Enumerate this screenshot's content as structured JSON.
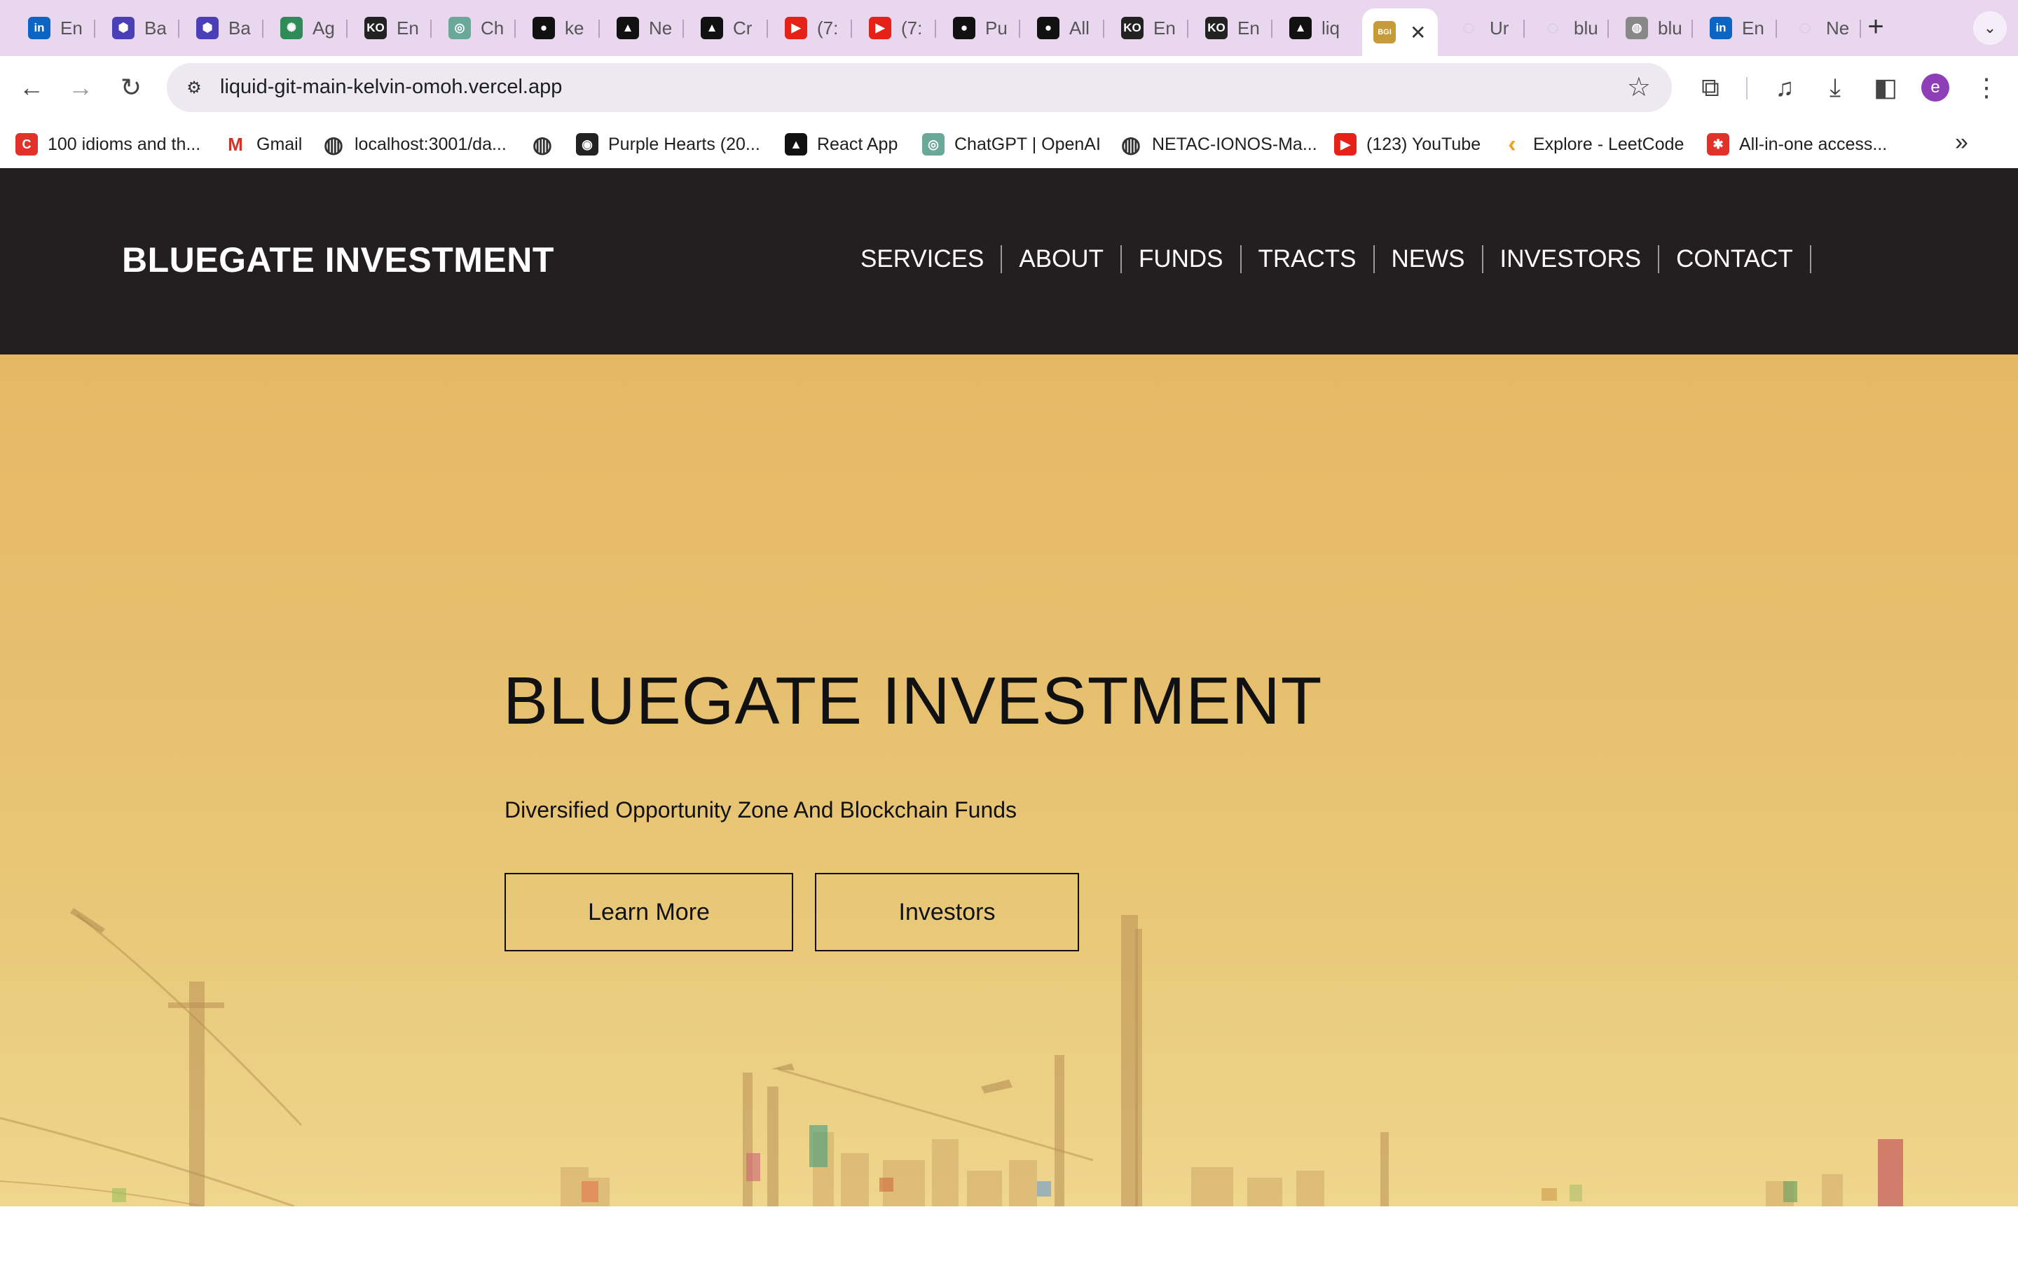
{
  "browser": {
    "tabs": [
      {
        "title": "En",
        "icon": "linkedin-icon",
        "color": "#0a66c2",
        "glyph": "in"
      },
      {
        "title": "Ba",
        "icon": "hexagon-icon",
        "color": "#4b3fb8",
        "glyph": "⬢"
      },
      {
        "title": "Ba",
        "icon": "hexagon-icon",
        "color": "#4b3fb8",
        "glyph": "⬢"
      },
      {
        "title": "Ag",
        "icon": "sparkle-icon",
        "color": "#2e8b57",
        "glyph": "✺"
      },
      {
        "title": "En",
        "icon": "ko-icon",
        "color": "#222222",
        "glyph": "KO"
      },
      {
        "title": "Ch",
        "icon": "openai-icon",
        "color": "#6aa89a",
        "glyph": "◎"
      },
      {
        "title": "ke",
        "icon": "github-icon",
        "color": "#111111",
        "glyph": "●"
      },
      {
        "title": "Ne",
        "icon": "vercel-icon",
        "color": "#111111",
        "glyph": "▲"
      },
      {
        "title": "Cr",
        "icon": "vercel-icon",
        "color": "#111111",
        "glyph": "▲"
      },
      {
        "title": "(7:",
        "icon": "youtube-icon",
        "color": "#e62117",
        "glyph": "▶"
      },
      {
        "title": "(7:",
        "icon": "youtube-icon",
        "color": "#e62117",
        "glyph": "▶"
      },
      {
        "title": "Pu",
        "icon": "github-icon",
        "color": "#111111",
        "glyph": "●"
      },
      {
        "title": "All",
        "icon": "github-icon",
        "color": "#111111",
        "glyph": "●"
      },
      {
        "title": "En",
        "icon": "ko-icon",
        "color": "#222222",
        "glyph": "KO"
      },
      {
        "title": "En",
        "icon": "ko-icon",
        "color": "#222222",
        "glyph": "KO"
      },
      {
        "title": "liq",
        "icon": "vercel-icon",
        "color": "#111111",
        "glyph": "▲"
      },
      {
        "title": "",
        "icon": "bgi-icon",
        "color": "#c79a3a",
        "glyph": "BGI",
        "active": true
      },
      {
        "title": "Ur",
        "icon": "loading-icon",
        "color": "#cfc3d6",
        "glyph": "◌"
      },
      {
        "title": "blu",
        "icon": "loading-icon",
        "color": "#cfc3d6",
        "glyph": "◌"
      },
      {
        "title": "blu",
        "icon": "globe-icon",
        "color": "#888888",
        "glyph": "◍"
      },
      {
        "title": "En",
        "icon": "linkedin-icon",
        "color": "#0a66c2",
        "glyph": "in"
      },
      {
        "title": "Ne",
        "icon": "loading-icon",
        "color": "#cfc3d6",
        "glyph": "◌"
      }
    ],
    "close_glyph": "✕",
    "new_tab_glyph": "+",
    "tab_search_glyph": "⌄",
    "back_glyph": "←",
    "forward_glyph": "→",
    "reload_glyph": "↻",
    "site_info_glyph": "⚙",
    "url": "liquid-git-main-kelvin-omoh.vercel.app",
    "bookmark_star_glyph": "☆",
    "extensions_glyph": "⧉",
    "media_glyph": "♫",
    "download_glyph": "⤓",
    "sidepanel_glyph": "◧",
    "menu_glyph": "⋮",
    "avatar_letter": "e",
    "bookmarks": [
      {
        "label": "100 idioms and th...",
        "icon": "c-icon",
        "color": "#e0312b",
        "glyph": "C"
      },
      {
        "label": "Gmail",
        "icon": "gmail-icon",
        "color": "#d93025",
        "glyph": "M"
      },
      {
        "label": "localhost:3001/da...",
        "icon": "globe-icon",
        "color": "#333333",
        "glyph": "◍"
      },
      {
        "label": "",
        "icon": "globe-icon",
        "color": "#333333",
        "glyph": "◍"
      },
      {
        "label": "Purple Hearts (20...",
        "icon": "disc-icon",
        "color": "#222222",
        "glyph": "◉"
      },
      {
        "label": "React App",
        "icon": "vercel-icon",
        "color": "#111111",
        "glyph": "▲"
      },
      {
        "label": "ChatGPT | OpenAI",
        "icon": "openai-icon",
        "color": "#6aa89a",
        "glyph": "◎"
      },
      {
        "label": "NETAC-IONOS-Ma...",
        "icon": "globe-icon",
        "color": "#333333",
        "glyph": "◍"
      },
      {
        "label": "(123) YouTube",
        "icon": "youtube-icon",
        "color": "#e62117",
        "glyph": "▶"
      },
      {
        "label": "Explore - LeetCode",
        "icon": "leetcode-icon",
        "color": "#f0a020",
        "glyph": "‹"
      },
      {
        "label": "All-in-one access...",
        "icon": "puzzle-icon",
        "color": "#e0312b",
        "glyph": "✱"
      }
    ],
    "bookmarks_more_glyph": "»"
  },
  "site": {
    "brand": "BLUEGATE INVESTMENT",
    "nav": [
      "SERVICES",
      "ABOUT",
      "FUNDS",
      "TRACTS",
      "NEWS",
      "INVESTORS",
      "CONTACT"
    ],
    "hero": {
      "title": "BLUEGATE INVESTMENT",
      "subtitle": "Diversified Opportunity Zone And Blockchain Funds",
      "primary_button": "Learn More",
      "secondary_button": "Investors"
    },
    "colors": {
      "header_bg": "#231f20",
      "hero_bg": "#e6bf6e"
    }
  }
}
